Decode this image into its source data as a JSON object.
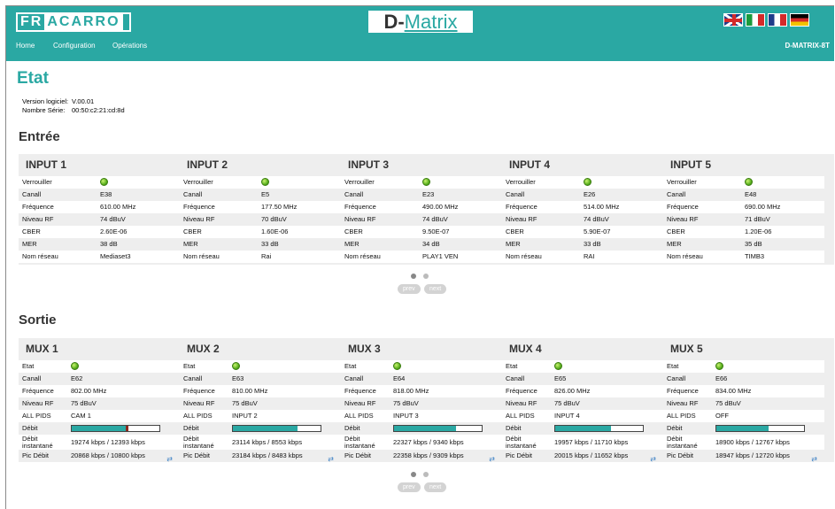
{
  "header": {
    "brand_left_1": "FR",
    "brand_left_2": "ACARRO",
    "brand_center_1": "D-",
    "brand_center_2": "Matrix",
    "nav": [
      "Home",
      "Configuration",
      "Opérations"
    ],
    "model": "D-MATRIX-8T",
    "flags": [
      "flag-uk-icon",
      "flag-it-icon",
      "flag-fr-icon",
      "flag-de-icon"
    ],
    "accent": "#2aa8a3"
  },
  "page": {
    "title": "Etat",
    "version_label": "Version logiciel:",
    "version_value": "V.00.01",
    "serial_label": "Nombre Série:",
    "serial_value": "00:50:c2:21:cd:8d"
  },
  "entree": {
    "title": "Entrée",
    "labels": [
      "Verrouiller",
      "Canall",
      "Fréquence",
      "Niveau RF",
      "CBER",
      "MER",
      "Nom réseau"
    ],
    "inputs": [
      {
        "name": "INPUT 1",
        "canal": "E38",
        "freq": "610.00 MHz",
        "rf": "74 dBuV",
        "cber": "2.60E-06",
        "mer": "38 dB",
        "net": "Mediaset3"
      },
      {
        "name": "INPUT 2",
        "canal": "E5",
        "freq": "177.50 MHz",
        "rf": "70 dBuV",
        "cber": "1.60E-06",
        "mer": "33 dB",
        "net": "Rai"
      },
      {
        "name": "INPUT 3",
        "canal": "E23",
        "freq": "490.00 MHz",
        "rf": "74 dBuV",
        "cber": "9.50E-07",
        "mer": "34 dB",
        "net": "PLAY1 VEN"
      },
      {
        "name": "INPUT 4",
        "canal": "E26",
        "freq": "514.00 MHz",
        "rf": "74 dBuV",
        "cber": "5.90E-07",
        "mer": "33 dB",
        "net": "RAI"
      },
      {
        "name": "INPUT 5",
        "canal": "E48",
        "freq": "690.00 MHz",
        "rf": "71 dBuV",
        "cber": "1.20E-06",
        "mer": "35 dB",
        "net": "TIMB3"
      }
    ],
    "prev": "prev",
    "next": "next"
  },
  "sortie": {
    "title": "Sortie",
    "labels": [
      "Etat",
      "Canall",
      "Fréquence",
      "Niveau RF",
      "ALL PIDS",
      "Débit",
      "Débit instantané",
      "Pic Débit"
    ],
    "muxes": [
      {
        "name": "MUX 1",
        "canal": "E62",
        "freq": "802.00 MHz",
        "rf": "75 dBuV",
        "pids": "CAM 1",
        "debit_fill": 0.62,
        "peak": 0.65,
        "inst": "19274 kbps / 12393 kbps",
        "pic": "20868 kbps / 10800 kbps"
      },
      {
        "name": "MUX 2",
        "canal": "E63",
        "freq": "810.00 MHz",
        "rf": "75 dBuV",
        "pids": "INPUT 2",
        "debit_fill": 0.74,
        "peak": null,
        "inst": "23114 kbps / 8553 kbps",
        "pic": "23184 kbps / 8483 kbps"
      },
      {
        "name": "MUX 3",
        "canal": "E64",
        "freq": "818.00 MHz",
        "rf": "75 dBuV",
        "pids": "INPUT 3",
        "debit_fill": 0.71,
        "peak": null,
        "inst": "22327 kbps / 9340 kbps",
        "pic": "22358 kbps / 9309 kbps"
      },
      {
        "name": "MUX 4",
        "canal": "E65",
        "freq": "826.00 MHz",
        "rf": "75 dBuV",
        "pids": "INPUT 4",
        "debit_fill": 0.64,
        "peak": null,
        "inst": "19957 kbps / 11710 kbps",
        "pic": "20015 kbps / 11652 kbps"
      },
      {
        "name": "MUX 5",
        "canal": "E66",
        "freq": "834.00 MHz",
        "rf": "75 dBuV",
        "pids": "OFF",
        "debit_fill": 0.6,
        "peak": null,
        "inst": "18900 kbps / 12767 kbps",
        "pic": "18947 kbps / 12720 kbps"
      }
    ],
    "prev": "prev",
    "next": "next"
  }
}
